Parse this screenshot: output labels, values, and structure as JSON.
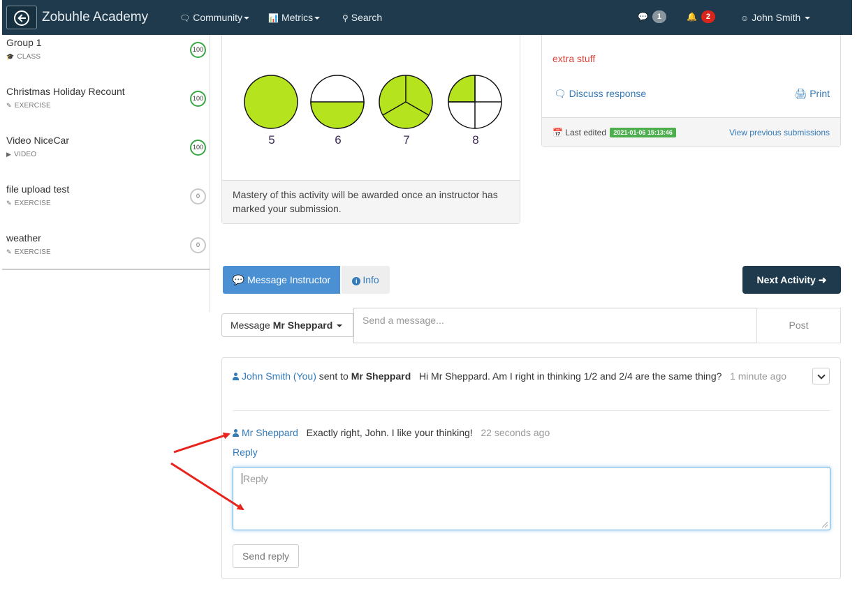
{
  "navbar": {
    "brand": "Zobuhle Academy",
    "community": "Community",
    "metrics": "Metrics",
    "search": "Search",
    "messages_count": "1",
    "notifications_count": "2",
    "user": "John Smith"
  },
  "sidebar": {
    "items": [
      {
        "title": "Group 1",
        "type": "CLASS",
        "score": "100"
      },
      {
        "title": "Christmas Holiday Recount",
        "type": "EXERCISE",
        "score": "100"
      },
      {
        "title": "Video NiceCar",
        "type": "VIDEO",
        "score": "100"
      },
      {
        "title": "file upload test",
        "type": "EXERCISE",
        "score": "0"
      },
      {
        "title": "weather",
        "type": "EXERCISE",
        "score": "0"
      }
    ]
  },
  "fractions": {
    "labels": [
      "5",
      "6",
      "7",
      "8"
    ],
    "fill_color": "#b5e41f",
    "footer": "Mastery of this activity will be awarded once an instructor has marked your submission."
  },
  "submission": {
    "extra": "extra stuff",
    "discuss": "Discuss response",
    "print": "Print",
    "last_edited_label": "Last edited",
    "last_edited_date": "2021-01-06 15:13:46",
    "view_previous": "View previous submissions"
  },
  "actions": {
    "message_instructor": "Message Instructor",
    "info": "Info",
    "next_activity": "Next Activity"
  },
  "compose": {
    "recipient_prefix": "Message",
    "recipient": "Mr Sheppard",
    "placeholder": "Send a message...",
    "post": "Post"
  },
  "thread": {
    "msg1": {
      "sender": "John Smith (You)",
      "sent_to": "sent to",
      "recipient": "Mr Sheppard",
      "text": "Hi Mr Sheppard. Am I right in thinking 1/2 and 2/4 are the same thing?",
      "time": "1 minute ago"
    },
    "msg2": {
      "sender": "Mr Sheppard",
      "text": "Exactly right, John. I like your thinking!",
      "time": "22 seconds ago"
    },
    "reply_link": "Reply",
    "reply_placeholder": "Reply",
    "send_reply": "Send reply"
  },
  "annotation_color": "#e8231c"
}
